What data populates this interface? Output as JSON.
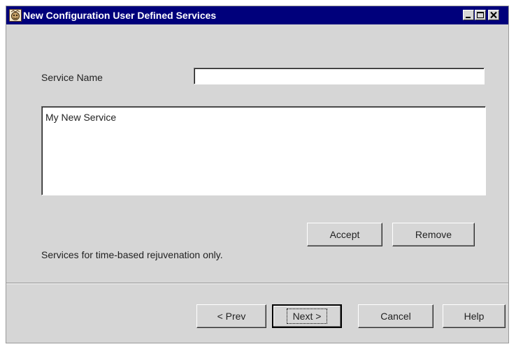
{
  "window": {
    "title": "New Configuration User Defined Services",
    "icon": "app-config-icon",
    "controls": {
      "minimize_icon": "minimize-icon",
      "maximize_icon": "maximize-icon",
      "close_icon": "close-icon"
    }
  },
  "form": {
    "service_name_label": "Service Name",
    "service_name_value": "",
    "services": [
      "My New Service"
    ],
    "accept_label": "Accept",
    "remove_label": "Remove",
    "note": "Services for time-based rejuvenation only."
  },
  "footer": {
    "prev_label": "< Prev",
    "next_label": "Next >",
    "cancel_label": "Cancel",
    "help_label": "Help"
  },
  "colors": {
    "titlebar": "#00007b",
    "dialog_bg": "#d6d6d6"
  }
}
